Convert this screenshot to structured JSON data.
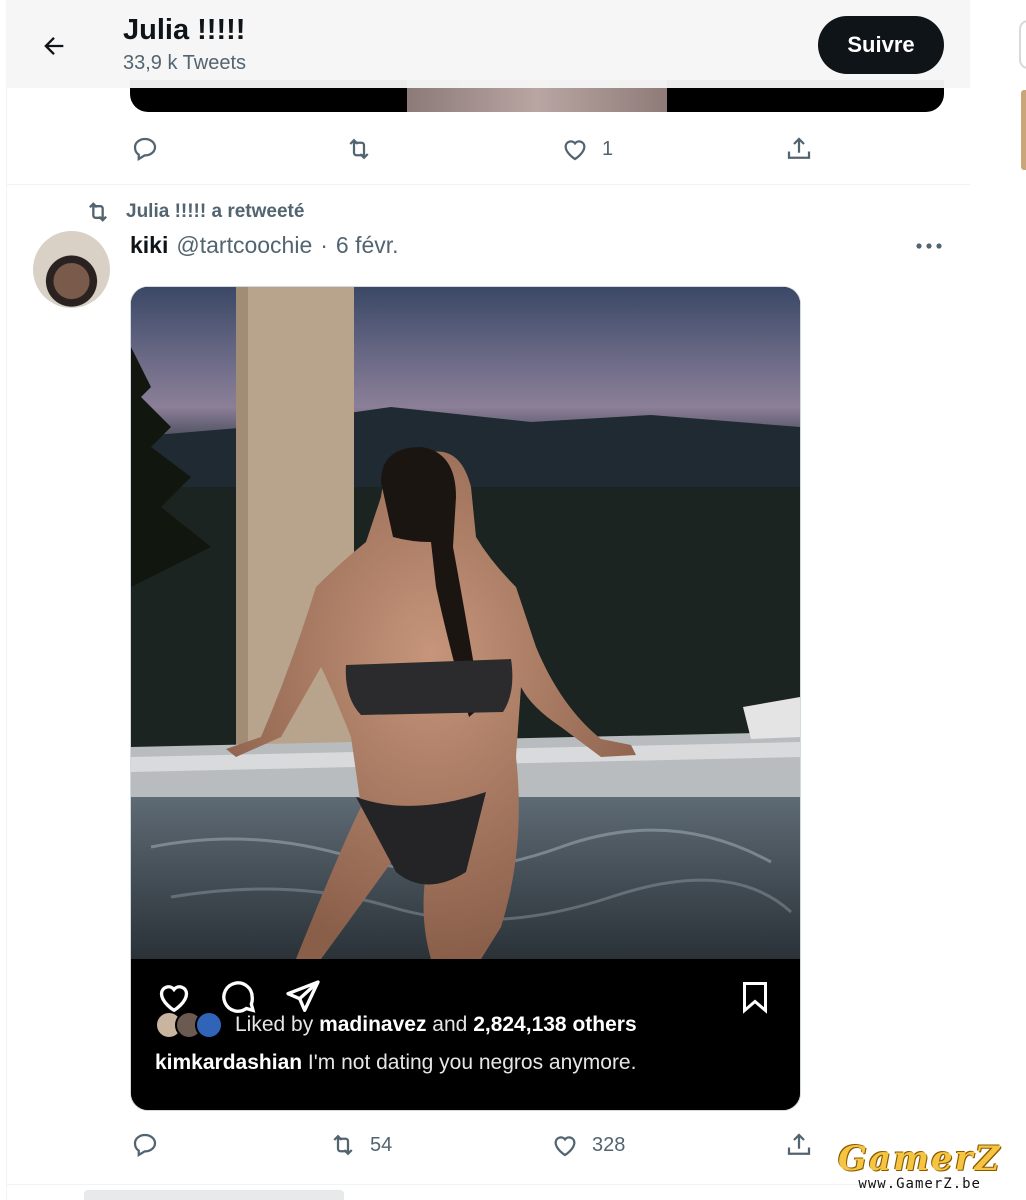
{
  "header": {
    "back_icon": "arrow-left-icon",
    "name": "Julia !!!!!",
    "tweet_count": "33,9 k Tweets",
    "follow_label": "Suivre"
  },
  "prev_tweet": {
    "actions": {
      "reply_count": "",
      "retweet_count": "",
      "like_count": "1"
    }
  },
  "tweet": {
    "retweet_context": "Julia !!!!! a retweeté",
    "author_name": "kiki",
    "author_handle": "@tartcoochie",
    "separator": "·",
    "date": "6 févr.",
    "media": {
      "liked_by_prefix": "Liked by",
      "liked_by_user": "madinavez",
      "liked_by_and": "and",
      "liked_by_others": "2,824,138 others",
      "caption_user": "kimkardashian",
      "caption_text": "I'm not dating you negros anymore."
    },
    "actions": {
      "reply_count": "",
      "retweet_count": "54",
      "like_count": "328"
    }
  },
  "watermark": {
    "logo": "GamerZ",
    "url": "www.GamerZ.be"
  },
  "colors": {
    "text_primary": "#0f1419",
    "text_secondary": "#536471",
    "follow_bg": "#0f1419",
    "border": "#eff3f4"
  }
}
